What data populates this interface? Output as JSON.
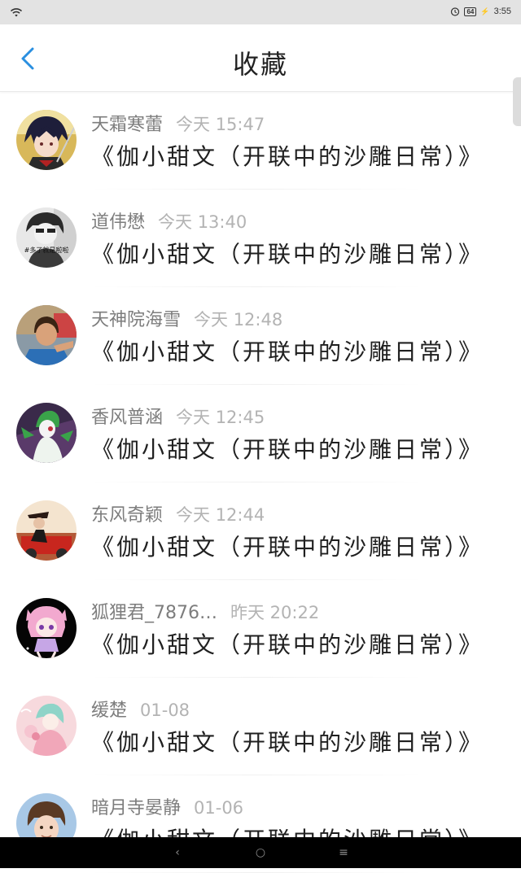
{
  "status_bar": {
    "battery": "64",
    "time": "3:55"
  },
  "header": {
    "title": "收藏"
  },
  "items": [
    {
      "name": "天霜寒蕾",
      "time": "今天 15:47",
      "post": "《伽小甜文（开联中的沙雕日常）》"
    },
    {
      "name": "道伟懋",
      "time": "今天 13:40",
      "post": "《伽小甜文（开联中的沙雕日常）》"
    },
    {
      "name": "天神院海雪",
      "time": "今天 12:48",
      "post": "《伽小甜文（开联中的沙雕日常）》"
    },
    {
      "name": "香风普涵",
      "time": "今天 12:45",
      "post": "《伽小甜文（开联中的沙雕日常）》"
    },
    {
      "name": "东风奇颖",
      "time": "今天 12:44",
      "post": "《伽小甜文（开联中的沙雕日常）》"
    },
    {
      "name": "狐狸君_7876…",
      "time": "昨天 20:22",
      "post": "《伽小甜文（开联中的沙雕日常）》"
    },
    {
      "name": "缓楚",
      "time": "01-08",
      "post": "《伽小甜文（开联中的沙雕日常）》"
    },
    {
      "name": "暗月寺晏静",
      "time": "01-06",
      "post": "《伽小甜文（开联中的沙雕日常）》"
    }
  ],
  "avatar_text": "#多了就是啦啦",
  "colors": {
    "accent": "#2a8fe0",
    "status_bar_bg": "#e3e3e3",
    "nav_bar_bg": "#000000"
  },
  "nav_bar": {
    "back_glyph": "‹",
    "home_glyph": "○",
    "menu_glyph": "≡"
  }
}
